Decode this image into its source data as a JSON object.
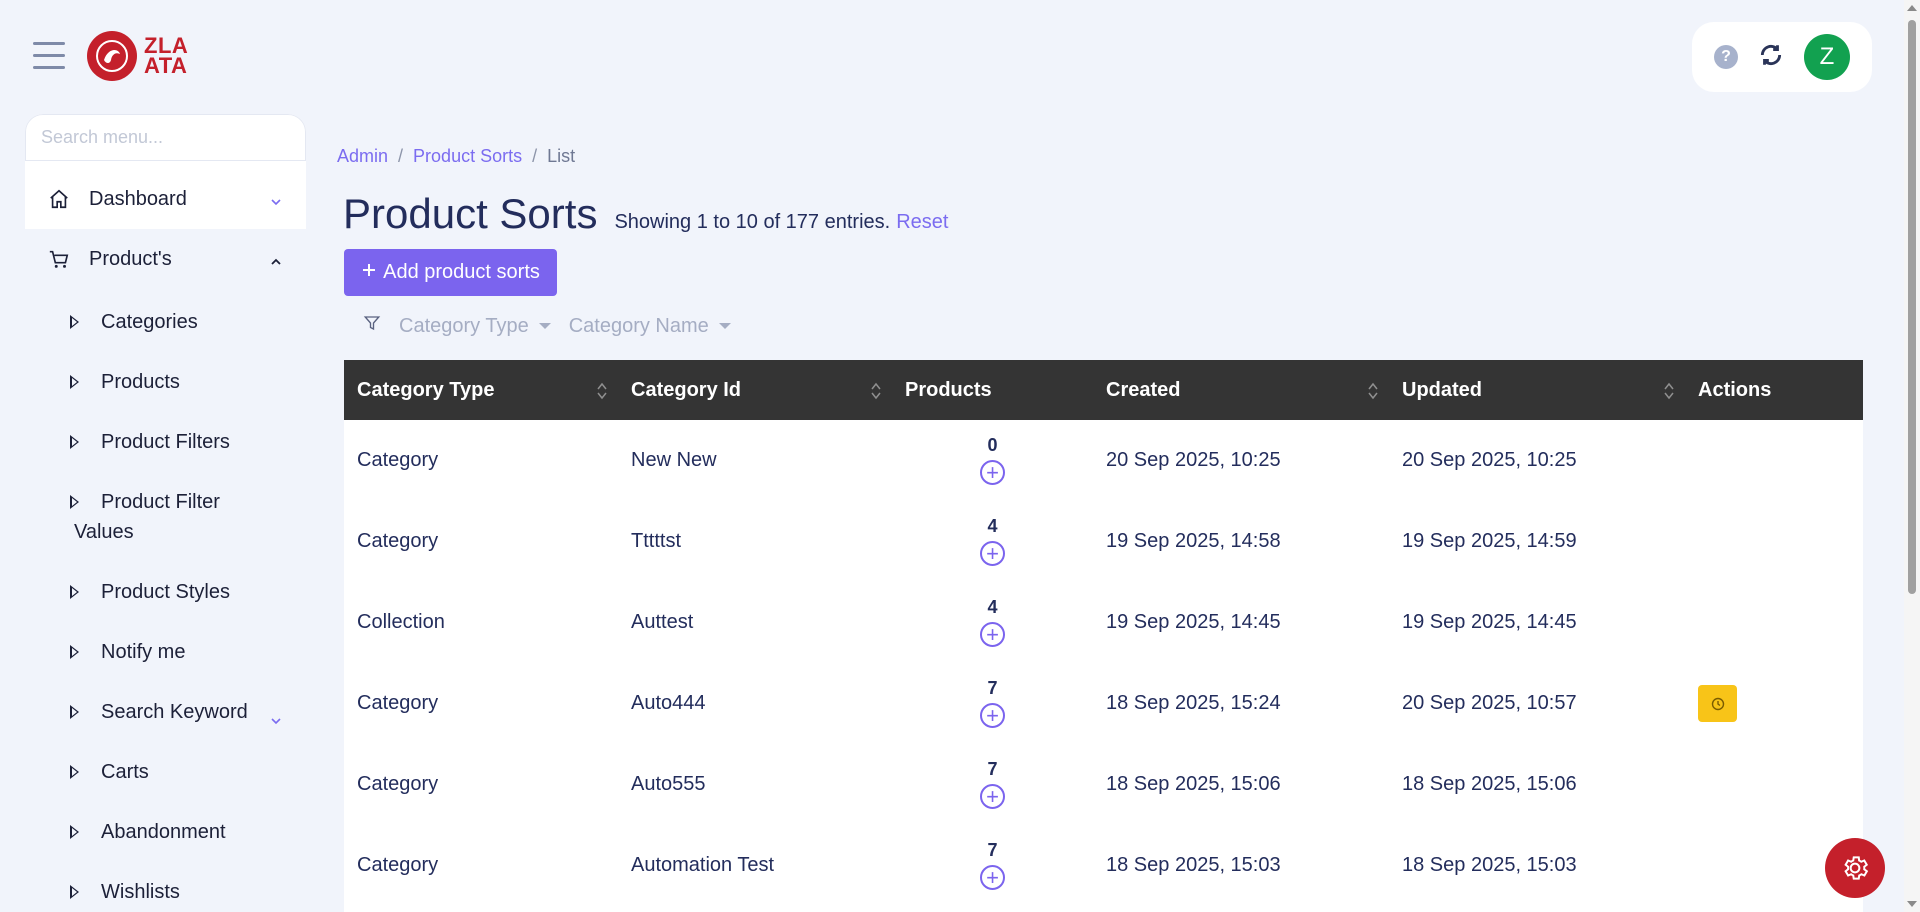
{
  "brand": {
    "logo_line1": "ZLA",
    "logo_line2": "ATA"
  },
  "header": {
    "avatar_letter": "Z",
    "help_symbol": "?"
  },
  "sidebar": {
    "search_placeholder": "Search menu...",
    "items": [
      {
        "label": "Dashboard",
        "icon": "home-icon"
      },
      {
        "label": "Product's",
        "icon": "cart-icon"
      }
    ],
    "sub_items": [
      "Categories",
      "Products",
      "Product Filters",
      "Product Filter Values",
      "Product Styles",
      "Notify me",
      "Search Keyword",
      "Carts",
      "Abandonment",
      "Wishlists"
    ]
  },
  "breadcrumb": {
    "items": [
      "Admin",
      "Product Sorts"
    ],
    "current": "List",
    "separator": "/"
  },
  "page": {
    "title": "Product Sorts",
    "entries_text": "Showing 1 to 10 of 177 entries.",
    "reset_label": "Reset",
    "add_label": "Add product sorts"
  },
  "filters": {
    "category_type": "Category Type",
    "category_name": "Category Name"
  },
  "table": {
    "headers": [
      "Category Type",
      "Category Id",
      "Products",
      "Created",
      "Updated",
      "Actions"
    ],
    "rows": [
      {
        "type": "Category",
        "id": "New New",
        "products": "0",
        "created": "20 Sep 2025, 10:25",
        "updated": "20 Sep 2025, 10:25",
        "has_action": false
      },
      {
        "type": "Category",
        "id": "Tttttst",
        "products": "4",
        "created": "19 Sep 2025, 14:58",
        "updated": "19 Sep 2025, 14:59",
        "has_action": false
      },
      {
        "type": "Collection",
        "id": "Auttest",
        "products": "4",
        "created": "19 Sep 2025, 14:45",
        "updated": "19 Sep 2025, 14:45",
        "has_action": false
      },
      {
        "type": "Category",
        "id": "Auto444",
        "products": "7",
        "created": "18 Sep 2025, 15:24",
        "updated": "20 Sep 2025, 10:57",
        "has_action": true
      },
      {
        "type": "Category",
        "id": "Auto555",
        "products": "7",
        "created": "18 Sep 2025, 15:06",
        "updated": "18 Sep 2025, 15:06",
        "has_action": false
      },
      {
        "type": "Category",
        "id": "Automation Test",
        "products": "7",
        "created": "18 Sep 2025, 15:03",
        "updated": "18 Sep 2025, 15:03",
        "has_action": false
      }
    ]
  },
  "colors": {
    "accent": "#7b64ee",
    "brand_red": "#c4202b",
    "header_dark": "#343434",
    "action_yellow": "#f8c418",
    "avatar_green": "#12a150"
  }
}
